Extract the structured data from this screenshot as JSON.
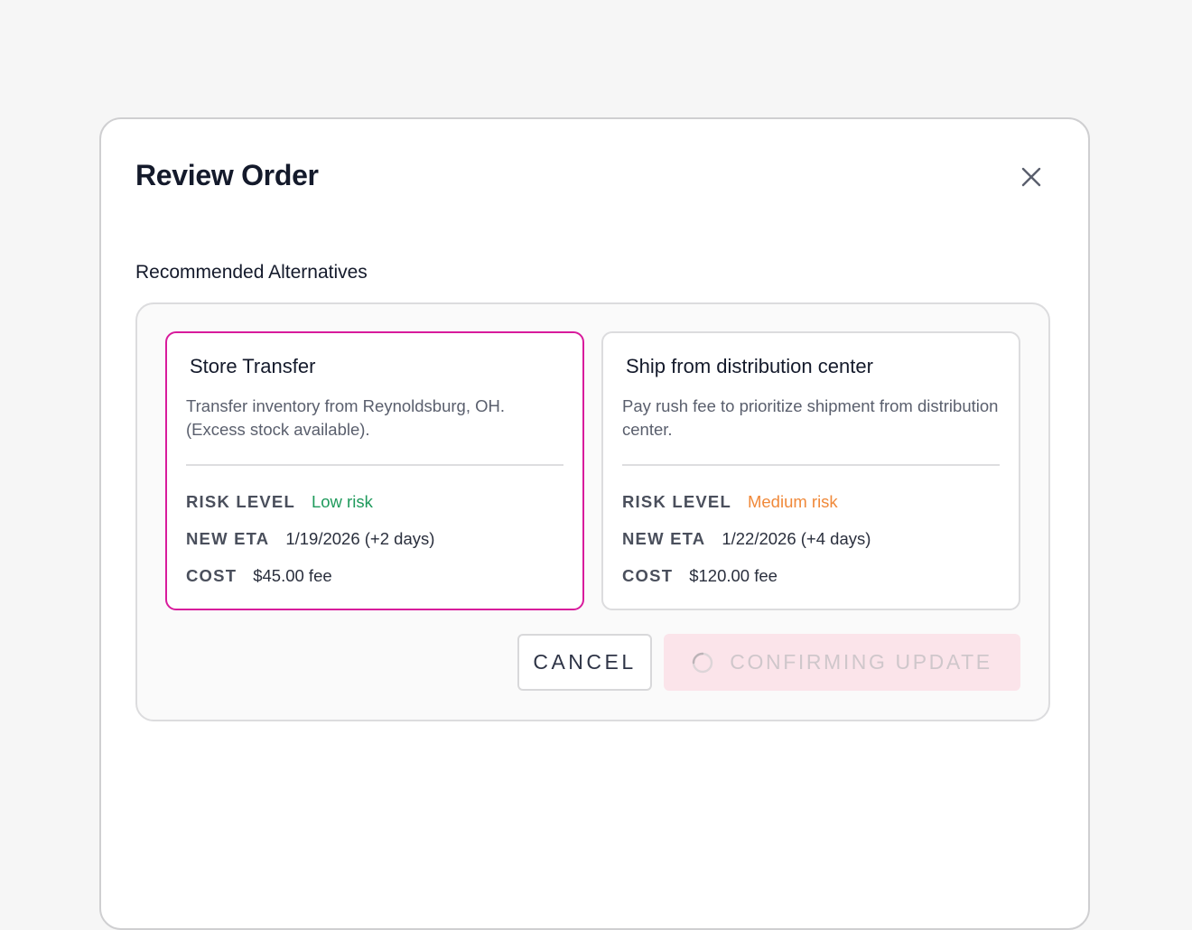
{
  "modal": {
    "title": "Review Order",
    "close_icon": "close-icon"
  },
  "section": {
    "title": "Recommended Alternatives"
  },
  "options": [
    {
      "title": "Store Transfer",
      "description": "Transfer inventory from Reynoldsburg, OH. (Excess stock available).",
      "risk_label": "RISK LEVEL",
      "risk_value": "Low risk",
      "eta_label": "NEW ETA",
      "eta_value": "1/19/2026 (+2 days)",
      "cost_label": "COST",
      "cost_value": "$45.00 fee",
      "selected": true
    },
    {
      "title": "Ship from distribution center",
      "description": "Pay rush fee to prioritize shipment from distribution center.",
      "risk_label": "RISK LEVEL",
      "risk_value": "Medium risk",
      "eta_label": "NEW ETA",
      "eta_value": "1/22/2026 (+4 days)",
      "cost_label": "COST",
      "cost_value": "$120.00 fee",
      "selected": false
    }
  ],
  "actions": {
    "cancel_label": "CANCEL",
    "confirm_label": "CONFIRMING UPDATE",
    "confirm_icon": "spinner-icon"
  },
  "colors": {
    "selected_border": "#d81b9c",
    "risk_low": "#1f9a5c",
    "risk_medium": "#f0893a",
    "confirm_bg": "#fbe4ea"
  }
}
